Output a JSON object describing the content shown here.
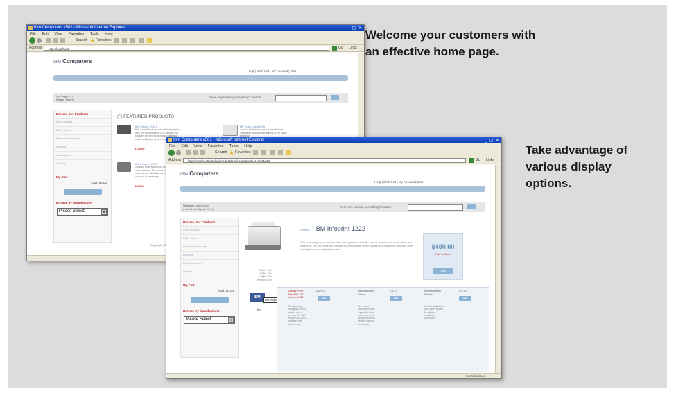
{
  "callouts": {
    "home": "Welcome your customers with an effective home page.",
    "display": "Take advantage of various display options."
  },
  "browser1": {
    "title": "Ibm Computers v501 - Microsoft Internet Explorer",
    "menu": [
      "File",
      "Edit",
      "View",
      "Favorites",
      "Tools",
      "Help"
    ],
    "toolbar": {
      "search": "Search",
      "favorites": "Favorites"
    },
    "address_label": "Address",
    "address": "http://localhost/",
    "go": "Go",
    "links": "Links",
    "site": {
      "logo": "Computers",
      "logo_mark": "IBM",
      "top_links": "Help  |  Wish List  |  My Account  |  Cart",
      "nav": [
        "Home",
        "Browse By...",
        "Quick Links"
      ],
      "greeting": "Not logged in",
      "greeting_sub": "Please Sign In",
      "search_prompt": "Seen any looking something?  Search",
      "sidebar_heading": "Browse Our Products",
      "sidebar_items": [
        "IBM Monitors",
        "IBM Printers",
        "Extended Warranty",
        "Laptops",
        "Accessories",
        "Options"
      ],
      "cart_heading": "My Cart",
      "cart_total": "Total: $0.00",
      "manufacturer_heading": "Browse by Manufacturer",
      "select_value": "Please Select",
      "featured_heading": "FEATURED PRODUCTS",
      "products": [
        {
          "title": "IBM Infoprint 1312",
          "desc": "With a small footprint and a fun expansive price, the IBM Infoprint 1312 delivers the functions needed for personal work and small workgroups performance.",
          "price": "$159.00"
        },
        {
          "title": "HP Color LaserJet 5",
          "desc": "It would be fine the words 'LaserJet' and 'affordable' would never appear in the same sentence.",
          "price": ""
        },
        {
          "title": "IBM Infoprint 1222",
          "desc": "Compact large workgroup printer without cost of printing. The printer has pages, high performance reliability and provides a low total cost of ownership.",
          "price": "$259.00"
        }
      ],
      "copyright": "Copyright 2004"
    }
  },
  "browser2": {
    "title": "Ibm Computers v501 - Microsoft Internet Explorer",
    "menu": [
      "File",
      "Edit",
      "View",
      "Favorites",
      "Tools",
      "Help"
    ],
    "toolbar": {
      "search": "Search",
      "favorites": "Favorites"
    },
    "address_label": "Address",
    "address": "http://localhost/catalog/productdetail.asp?product=IBM1222",
    "go": "Go",
    "links": "Links",
    "status_text": "Local intranet",
    "site": {
      "logo": "Computers",
      "logo_mark": "IBM",
      "top_links": "Help  |  Wish List  |  My Account  |  Cart",
      "nav": [
        "Home",
        "Browse By...",
        "Quick Links"
      ],
      "greeting": "Welcome back John!",
      "greeting_sub": "(not John? Sign In Here)",
      "search_prompt": "Seen any looking something?  Search",
      "sidebar_heading": "Browse Our Products",
      "sidebar_items": [
        "IBM Monitors",
        "IBM Printers",
        "Extended Warranty",
        "Laptops",
        "PC Accessories",
        "Options"
      ],
      "cart_heading": "My Cart",
      "cart_total": "Total: $0.00",
      "manufacturer_heading": "Browse by Manufacturer",
      "select_value": "Please Select",
      "product_brand": "Printers",
      "product_title": "IBM Infoprint 1222",
      "product_desc": "Give your workgroup or small business the speed and reliability it needs, at a low cost of acquisition and ownership. The low profile IBM Infoprint 1222 mono laser printer is a fits-most-anywhere, high-yield toner cartridges reduce supply interventions.",
      "price": "$450.00",
      "stock": "Add to Wish",
      "add_button": "Add",
      "specs": [
        "Depth: 16 in",
        "Width: 15 in",
        "Height: 15 in",
        "Weight: 30 lbs"
      ],
      "recommendations": [
        {
          "name": "Lexmark Pro+ Stand Kit 1222 Infoprint 1222",
          "price": "$567.00",
          "more": "Compact large workgroup printer without cost of printing. The IBM Infoprint 1222 is a versatile, high performance"
        },
        {
          "name": "Recommended Service",
          "price": "$45.00",
          "more": "One year of extended on site support for three years, day of the week provided by certified support technicians"
        },
        {
          "name": "Recommended Service",
          "price": "$75.00",
          "more": "Onsite installation of your printer system by certified installation technicians"
        }
      ],
      "ibm_badge": "IBM",
      "tooltip": "IBM Infoprint Printers",
      "tooltip_caption": "Ibm"
    }
  }
}
